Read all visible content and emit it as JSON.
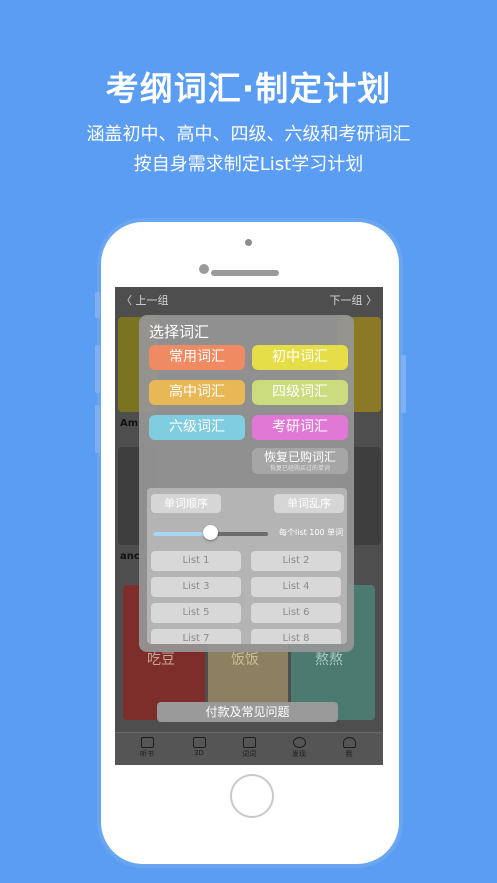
{
  "headline": "考纲词汇·制定计划",
  "subline1": "涵盖初中、高中、四级、六级和考研词汇",
  "subline2": "按自身需求制定List学习计划",
  "nav": {
    "prev": "〈 上一组",
    "next": "下一组 〉"
  },
  "background": {
    "label_top": "Am",
    "label_mid": "anc",
    "cards_bottom": [
      "吃豆",
      "饭饭",
      "熬熬"
    ]
  },
  "panel": {
    "title": "选择词汇",
    "vocab": [
      {
        "label": "常用词汇",
        "color": "#f08a62"
      },
      {
        "label": "初中词汇",
        "color": "#e6de48"
      },
      {
        "label": "高中词汇",
        "color": "#e8b856"
      },
      {
        "label": "四级词汇",
        "color": "#cbdc7e"
      },
      {
        "label": "六级词汇",
        "color": "#80cde0"
      },
      {
        "label": "考研词汇",
        "color": "#e278d6"
      }
    ],
    "restore_title": "恢复已购词汇",
    "restore_sub": "恢复已经购买过的单词",
    "order_sequential": "单词顺序",
    "order_random": "单词乱序",
    "slider_caption": "每个list 100 单词",
    "slider_value": 0.5,
    "lists": [
      "List 1",
      "List 2",
      "List 3",
      "List 4",
      "List 5",
      "List 6",
      "List 7",
      "List 8"
    ]
  },
  "faq": "付款及常见问题",
  "tabs": [
    "听书",
    "3D",
    "词词",
    "发现",
    "我"
  ]
}
